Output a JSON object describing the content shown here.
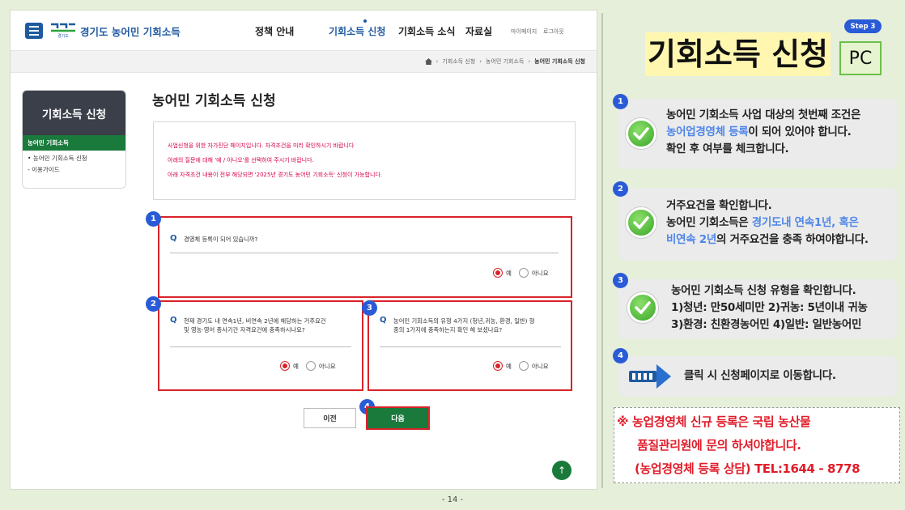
{
  "nav": {
    "logo_text": "경기도 농어민 기회소득",
    "logo_mark": "경기도",
    "items": [
      "정책 안내",
      "기회소득 신청",
      "기회소득 소식",
      "자료실"
    ],
    "small": [
      "마이페이지",
      "로그아웃"
    ]
  },
  "breadcrumb": [
    "기회소득 신청",
    "농어민 기회소득",
    "농어민 기회소득 신청"
  ],
  "sidebar": {
    "title": "기회소득 신청",
    "active": "농어민 기회소득",
    "items": [
      "• 농어민 기회소득 신청",
      "- 이용가이드"
    ]
  },
  "page_title": "농어민 기회소득 신청",
  "notice": [
    "사업신청을 위한 자가진단 페이지입니다. 자격조건을 미리 확인하시기 바랍니다",
    "아래의 질문에 대해 '예 / 아니오'를 선택하여 주시기 바랍니다.",
    "아래 자격조건 내용이 전부 해당되면 '2025년 경기도 농어민 기회소득' 신청이 가능합니다."
  ],
  "questions": [
    {
      "q": "Q",
      "line1": "경영체 등록이 되어 있습니까?",
      "line2": "",
      "yes": "예",
      "no": "아니요"
    },
    {
      "q": "Q",
      "line1": "현재 경기도 내 연속1년, 비연속 2년에 해당하는 거주요건",
      "line2": "및 영농·영어 종사기간 자격요건에 충족하시나요?",
      "yes": "예",
      "no": "아니요"
    },
    {
      "q": "Q",
      "line1": "농어민 기회소득의 유형 4가지 (청년,귀농, 환경, 일반) 형",
      "line2": "중의 1가지에 충족하는지 확인 해 보셨나요?",
      "yes": "예",
      "no": "아니요"
    }
  ],
  "badges": [
    "1",
    "2",
    "3",
    "4"
  ],
  "buttons": {
    "prev": "이전",
    "next": "다음",
    "top": "↑"
  },
  "page_number": "- 14 -",
  "right": {
    "step": "Step 3",
    "title": "기회소득 신청",
    "pc": "PC",
    "cards": [
      {
        "n": "1",
        "lines": [
          [
            "농어민 기회소득 사업 대상의 첫번째 조건은",
            ""
          ],
          [
            "",
            "농어업경영체 등록",
            "이 되어 있어야 합니다."
          ],
          [
            "확인 후 여부를 체크합니다.",
            ""
          ]
        ]
      },
      {
        "n": "2",
        "lines": [
          [
            "거주요건을 확인합니다.",
            ""
          ],
          [
            "농어민 기회소득은 ",
            "경기도내 연속1년, 혹은",
            ""
          ],
          [
            "",
            "비연속 2년",
            "의 거주요건을 충족 하여야합니다."
          ]
        ]
      },
      {
        "n": "3",
        "lines": [
          [
            "농어민 기회소득 신청 유형을 확인합니다.",
            ""
          ],
          [
            "1)청년: 만50세미만  2)귀농: 5년이내 귀농",
            ""
          ],
          [
            "3)환경: 친환경농어민 4)일반: 일반농어민",
            ""
          ]
        ]
      },
      {
        "n": "4",
        "lines": [
          [
            "클릭 시 신청페이지로 이동합니다.",
            ""
          ]
        ]
      }
    ],
    "note": [
      "※ 농업경영체 신규 등록은 국립 농산물",
      "품질관리원에 문의 하셔야합니다.",
      "(농업경영체 등록 상담) TEL:1644 - 8778"
    ]
  },
  "colors": {
    "brand": "#1f5aa0",
    "green": "#1a7a3c",
    "red": "#d8232a",
    "badge": "#2a5bd7",
    "highlight": "#4f86e8"
  }
}
